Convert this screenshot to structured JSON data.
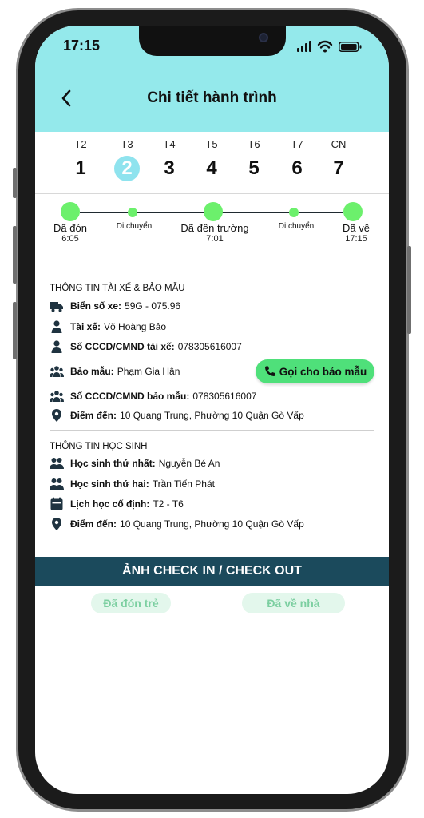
{
  "status_bar": {
    "time": "17:15"
  },
  "header": {
    "title": "Chi tiết hành trình"
  },
  "week": {
    "days": [
      {
        "label": "T2",
        "number": "1",
        "active": false
      },
      {
        "label": "T3",
        "number": "2",
        "active": true
      },
      {
        "label": "T4",
        "number": "3",
        "active": false
      },
      {
        "label": "T5",
        "number": "4",
        "active": false
      },
      {
        "label": "T6",
        "number": "5",
        "active": false
      },
      {
        "label": "T7",
        "number": "6",
        "active": false
      },
      {
        "label": "CN",
        "number": "7",
        "active": false
      }
    ]
  },
  "timeline": {
    "steps": [
      {
        "label": "Đã đón",
        "time": "6:05"
      },
      {
        "label": "Di chuyển",
        "time": ""
      },
      {
        "label": "Đã đến trường",
        "time": "7:01"
      },
      {
        "label": "Di chuyển",
        "time": ""
      },
      {
        "label": "Đã về",
        "time": "17:15"
      }
    ]
  },
  "driver_section": {
    "title": "THÔNG TIN TÀI XẾ & BẢO MẪU",
    "plate_label": "Biển số xe:",
    "plate_value": "59G - 075.96",
    "driver_label": "Tài xế:",
    "driver_value": "Võ Hoàng Bảo",
    "driver_id_label": "Số CCCD/CMND tài xế:",
    "driver_id_value": "078305616007",
    "nanny_label": "Bảo mẫu:",
    "nanny_value": "Phạm Gia Hân",
    "call_button": "Gọi cho bảo mẫu",
    "nanny_id_label": "Số CCCD/CMND bảo mẫu:",
    "nanny_id_value": "078305616007",
    "destination_label": "Điểm đến:",
    "destination_value": "10 Quang Trung, Phường 10 Quận Gò Vấp"
  },
  "student_section": {
    "title": "THÔNG TIN HỌC SINH",
    "first_label": "Học sinh thứ nhất:",
    "first_value": "Nguyễn Bé An",
    "second_label": "Học sinh thứ hai:",
    "second_value": "Trần Tiến Phát",
    "schedule_label": "Lịch học cố định:",
    "schedule_value": "T2 - T6",
    "destination_label": "Điểm đến:",
    "destination_value": "10 Quang Trung, Phường 10 Quận Gò Vấp"
  },
  "checkin": {
    "title": "ẢNH CHECK IN / CHECK OUT",
    "picked_up": "Đã đón trẻ",
    "arrived_home": "Đã về nhà"
  },
  "colors": {
    "header_bg": "#94e9eb",
    "timeline_node": "#6cf06c",
    "call_button": "#4fe07a",
    "checkin_bar": "#1b4a5c",
    "pill_bg": "#e3f7ec",
    "pill_text": "#7ccfa1"
  },
  "icons": {
    "back": "chevron-left-icon",
    "signal": "signal-icon",
    "wifi": "wifi-icon",
    "battery": "battery-icon",
    "truck": "truck-icon",
    "person": "person-icon",
    "group": "group-icon",
    "pin": "map-pin-icon",
    "phone": "phone-icon",
    "calendar": "calendar-icon"
  }
}
